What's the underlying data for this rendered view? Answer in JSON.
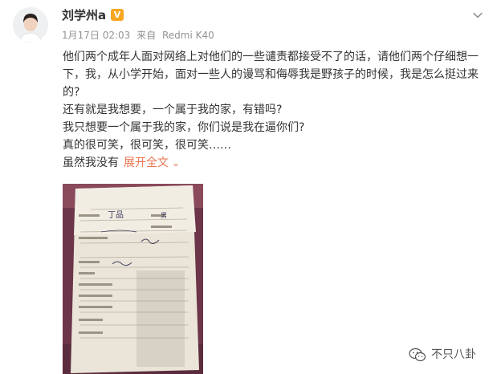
{
  "user": {
    "name": "刘学州a",
    "verified_badge": "V"
  },
  "post": {
    "date": "1月17日 02:03",
    "source_prefix": "来自",
    "device": "Redmi K40",
    "paragraphs": [
      "他们两个成年人面对网络上对他们的一些谴责都接受不了的话，请他们两个仔细想一下，我，从小学开始，面对一些人的谩骂和侮辱我是野孩子的时候，我是怎么挺过来的?",
      "还有就是我想要，一个属于我的家，有错吗?",
      "我只想要一个属于我的家，你们说是我在逼你们?",
      "真的很可笑，很可笑，很可笑……"
    ],
    "truncated_text": "虽然我没有",
    "expand_label": "展开全文",
    "expand_icon": "chevron-down-icon",
    "more_icon": "chevron-down-icon"
  },
  "photo": {
    "handwriting_name": "丁品",
    "handwriting_gender": "男"
  },
  "watermark": {
    "text": "不只八卦",
    "icon": "wechat-icon"
  },
  "colors": {
    "link": "#eb7350",
    "meta": "#939393",
    "text": "#333333",
    "badge": "#f6a623"
  }
}
